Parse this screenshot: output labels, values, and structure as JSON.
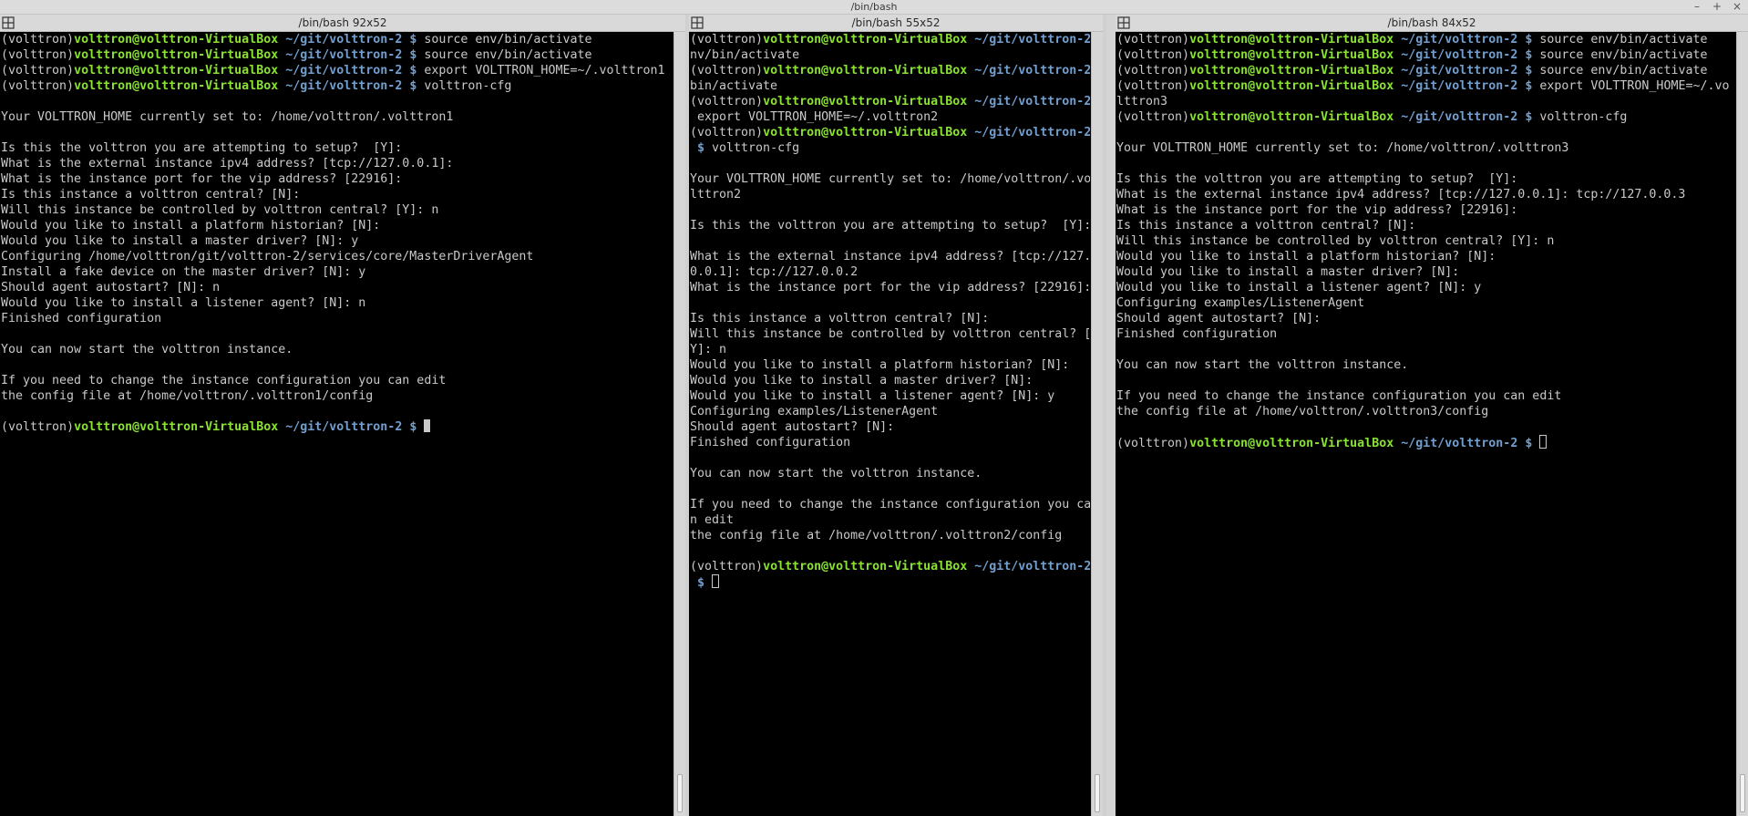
{
  "window": {
    "title": "/bin/bash",
    "controls": [
      "–",
      "+",
      "×"
    ]
  },
  "panes": [
    {
      "title": "/bin/bash 92x52",
      "lines": [
        {
          "p": [
            "(volttron)",
            "volttron@volttron-VirtualBox",
            "~/git/volttron-2 $"
          ],
          "t": " source env/bin/activate"
        },
        {
          "p": [
            "(volttron)",
            "volttron@volttron-VirtualBox",
            "~/git/volttron-2 $"
          ],
          "t": " source env/bin/activate"
        },
        {
          "p": [
            "(volttron)",
            "volttron@volttron-VirtualBox",
            "~/git/volttron-2 $"
          ],
          "t": " export VOLTTRON_HOME=~/.volttron1"
        },
        {
          "p": [
            "(volttron)",
            "volttron@volttron-VirtualBox",
            "~/git/volttron-2 $"
          ],
          "t": " volttron-cfg"
        },
        {
          "t": ""
        },
        {
          "t": "Your VOLTTRON_HOME currently set to: /home/volttron/.volttron1"
        },
        {
          "t": ""
        },
        {
          "t": "Is this the volttron you are attempting to setup?  [Y]:"
        },
        {
          "t": "What is the external instance ipv4 address? [tcp://127.0.0.1]:"
        },
        {
          "t": "What is the instance port for the vip address? [22916]:"
        },
        {
          "t": "Is this instance a volttron central? [N]:"
        },
        {
          "t": "Will this instance be controlled by volttron central? [Y]: n"
        },
        {
          "t": "Would you like to install a platform historian? [N]:"
        },
        {
          "t": "Would you like to install a master driver? [N]: y"
        },
        {
          "t": "Configuring /home/volttron/git/volttron-2/services/core/MasterDriverAgent"
        },
        {
          "t": "Install a fake device on the master driver? [N]: y"
        },
        {
          "t": "Should agent autostart? [N]: n"
        },
        {
          "t": "Would you like to install a listener agent? [N]: n"
        },
        {
          "t": "Finished configuration"
        },
        {
          "t": ""
        },
        {
          "t": "You can now start the volttron instance."
        },
        {
          "t": ""
        },
        {
          "t": "If you need to change the instance configuration you can edit"
        },
        {
          "t": "the config file at /home/volttron/.volttron1/config"
        },
        {
          "t": ""
        },
        {
          "p": [
            "(volttron)",
            "volttron@volttron-VirtualBox",
            "~/git/volttron-2 $"
          ],
          "t": " ",
          "cursor": "solid"
        }
      ]
    },
    {
      "title": "/bin/bash 55x52",
      "lines": [
        {
          "p": [
            "(volttron)",
            "volttron@volttron-VirtualBox",
            "~/git/volttron-2"
          ],
          "t": ""
        },
        {
          "t": "nv/bin/activate"
        },
        {
          "p": [
            "(volttron)",
            "volttron@volttron-VirtualBox",
            "~/git/volttron-2"
          ],
          "t": ""
        },
        {
          "t": "bin/activate"
        },
        {
          "p": [
            "(volttron)",
            "volttron@volttron-VirtualBox",
            "~/git/volttron-2"
          ],
          "t": ""
        },
        {
          "t": " export VOLTTRON_HOME=~/.volttron2"
        },
        {
          "p": [
            "(volttron)",
            "volttron@volttron-VirtualBox",
            "~/git/volttron-2"
          ],
          "t": ""
        },
        {
          "p": [
            "",
            "",
            " $"
          ],
          "t": " volttron-cfg"
        },
        {
          "t": ""
        },
        {
          "t": "Your VOLTTRON_HOME currently set to: /home/volttron/.vo"
        },
        {
          "t": "lttron2"
        },
        {
          "t": ""
        },
        {
          "t": "Is this the volttron you are attempting to setup?  [Y]:"
        },
        {
          "t": ""
        },
        {
          "t": "What is the external instance ipv4 address? [tcp://127."
        },
        {
          "t": "0.0.1]: tcp://127.0.0.2"
        },
        {
          "t": "What is the instance port for the vip address? [22916]:"
        },
        {
          "t": ""
        },
        {
          "t": "Is this instance a volttron central? [N]:"
        },
        {
          "t": "Will this instance be controlled by volttron central? ["
        },
        {
          "t": "Y]: n"
        },
        {
          "t": "Would you like to install a platform historian? [N]:"
        },
        {
          "t": "Would you like to install a master driver? [N]:"
        },
        {
          "t": "Would you like to install a listener agent? [N]: y"
        },
        {
          "t": "Configuring examples/ListenerAgent"
        },
        {
          "t": "Should agent autostart? [N]:"
        },
        {
          "t": "Finished configuration"
        },
        {
          "t": ""
        },
        {
          "t": "You can now start the volttron instance."
        },
        {
          "t": ""
        },
        {
          "t": "If you need to change the instance configuration you ca"
        },
        {
          "t": "n edit"
        },
        {
          "t": "the config file at /home/volttron/.volttron2/config"
        },
        {
          "t": ""
        },
        {
          "p": [
            "(volttron)",
            "volttron@volttron-VirtualBox",
            "~/git/volttron-2"
          ],
          "t": ""
        },
        {
          "p": [
            "",
            "",
            " $"
          ],
          "t": " ",
          "cursor": "hollow"
        }
      ]
    },
    {
      "title": "/bin/bash 84x52",
      "lines": [
        {
          "p": [
            "(volttron)",
            "volttron@volttron-VirtualBox",
            "~/git/volttron-2 $"
          ],
          "t": " source env/bin/activate"
        },
        {
          "p": [
            "(volttron)",
            "volttron@volttron-VirtualBox",
            "~/git/volttron-2 $"
          ],
          "t": " source env/bin/activate"
        },
        {
          "p": [
            "(volttron)",
            "volttron@volttron-VirtualBox",
            "~/git/volttron-2 $"
          ],
          "t": " source env/bin/activate"
        },
        {
          "p": [
            "(volttron)",
            "volttron@volttron-VirtualBox",
            "~/git/volttron-2 $"
          ],
          "t": " export VOLTTRON_HOME=~/.vo"
        },
        {
          "t": "lttron3"
        },
        {
          "p": [
            "(volttron)",
            "volttron@volttron-VirtualBox",
            "~/git/volttron-2 $"
          ],
          "t": " volttron-cfg"
        },
        {
          "t": ""
        },
        {
          "t": "Your VOLTTRON_HOME currently set to: /home/volttron/.volttron3"
        },
        {
          "t": ""
        },
        {
          "t": "Is this the volttron you are attempting to setup?  [Y]:"
        },
        {
          "t": "What is the external instance ipv4 address? [tcp://127.0.0.1]: tcp://127.0.0.3"
        },
        {
          "t": "What is the instance port for the vip address? [22916]:"
        },
        {
          "t": "Is this instance a volttron central? [N]:"
        },
        {
          "t": "Will this instance be controlled by volttron central? [Y]: n"
        },
        {
          "t": "Would you like to install a platform historian? [N]:"
        },
        {
          "t": "Would you like to install a master driver? [N]:"
        },
        {
          "t": "Would you like to install a listener agent? [N]: y"
        },
        {
          "t": "Configuring examples/ListenerAgent"
        },
        {
          "t": "Should agent autostart? [N]:"
        },
        {
          "t": "Finished configuration"
        },
        {
          "t": ""
        },
        {
          "t": "You can now start the volttron instance."
        },
        {
          "t": ""
        },
        {
          "t": "If you need to change the instance configuration you can edit"
        },
        {
          "t": "the config file at /home/volttron/.volttron3/config"
        },
        {
          "t": ""
        },
        {
          "p": [
            "(volttron)",
            "volttron@volttron-VirtualBox",
            "~/git/volttron-2 $"
          ],
          "t": " ",
          "cursor": "hollow"
        }
      ]
    }
  ]
}
